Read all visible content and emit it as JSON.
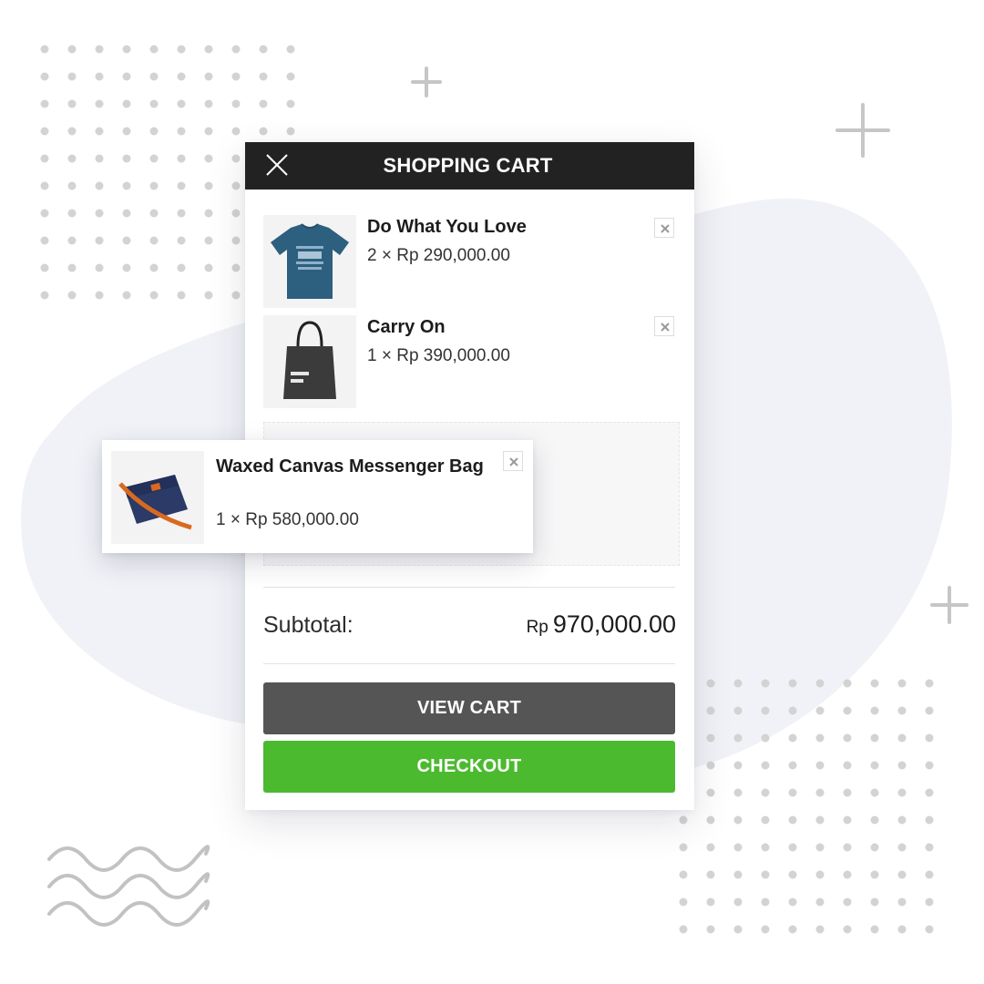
{
  "cart": {
    "title": "SHOPPING CART",
    "items": [
      {
        "name": "Do What You Love",
        "qty_price": "2 ×  Rp  290,000.00",
        "thumb_text": "DO WHAT YOU LOVE WHAT YOU DO"
      },
      {
        "name": "Carry On",
        "qty_price": "1 ×  Rp  390,000.00",
        "thumb_text_line1": "carry",
        "thumb_text_line2": "on"
      }
    ],
    "dragged_item": {
      "name": "Waxed Canvas Messenger Bag",
      "qty_price": "1 ×  Rp  580,000.00"
    },
    "subtotal": {
      "label": "Subtotal:",
      "currency": "Rp",
      "amount": "970,000.00"
    },
    "view_cart_label": "VIEW CART",
    "checkout_label": "CHECKOUT"
  },
  "colors": {
    "header": "#222222",
    "view_cart": "#555555",
    "checkout": "#4bba2f",
    "blob": "#f1f2f7",
    "decor": "#cfcfcf"
  },
  "icons": [
    "close-icon",
    "remove-icon",
    "plus-icon",
    "wave-icon"
  ]
}
